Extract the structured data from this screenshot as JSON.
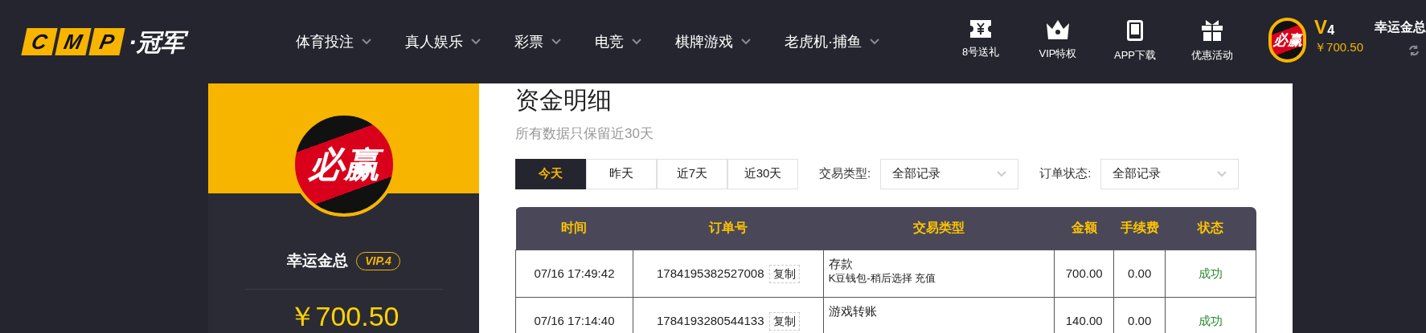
{
  "header": {
    "logo": {
      "letters": [
        "C",
        "M",
        "P"
      ],
      "name": "·冠军"
    },
    "nav": [
      {
        "label": "体育投注"
      },
      {
        "label": "真人娱乐"
      },
      {
        "label": "彩票"
      },
      {
        "label": "电竞"
      },
      {
        "label": "棋牌游戏"
      },
      {
        "label": "老虎机·捕鱼"
      }
    ],
    "quick_links": [
      {
        "kind": "ticket",
        "label": "8号送礼"
      },
      {
        "kind": "crown",
        "label": "VIP特权"
      },
      {
        "kind": "tablet",
        "label": "APP下载"
      },
      {
        "kind": "gift",
        "label": "优惠活动"
      }
    ],
    "user": {
      "avatar_text": "必赢",
      "vip_letter": "V",
      "vip_level": "4",
      "balance": "￥700.50",
      "name": "幸运金总"
    }
  },
  "profile": {
    "avatar_text": "必赢",
    "name": "幸运金总",
    "vip_badge": "VIP.4",
    "balance": "￥700.50"
  },
  "funds": {
    "title": "资金明细",
    "subtitle": "所有数据只保留近30天",
    "periods": [
      {
        "label": "今天",
        "selected": true
      },
      {
        "label": "昨天",
        "selected": false
      },
      {
        "label": "近7天",
        "selected": false
      },
      {
        "label": "近30天",
        "selected": false
      }
    ],
    "filters": [
      {
        "label": "交易类型:",
        "value": "全部记录"
      },
      {
        "label": "订单状态:",
        "value": "全部记录"
      }
    ],
    "table": {
      "columns": [
        "时间",
        "订单号",
        "交易类型",
        "金额",
        "手续费",
        "状态"
      ],
      "rows": [
        {
          "time": "07/16 17:49:42",
          "order_no": "1784195382527008",
          "copy": "复制",
          "type": "存款",
          "type_detail": "K豆钱包-稍后选择 充值",
          "amount": "700.00",
          "fee": "0.00",
          "status": "成功"
        },
        {
          "time": "07/16 17:14:40",
          "order_no": "1784193280544133",
          "copy": "复制",
          "type": "游戏转账",
          "amount": "140.00",
          "fee": "0.00",
          "status": "成功"
        }
      ]
    }
  }
}
